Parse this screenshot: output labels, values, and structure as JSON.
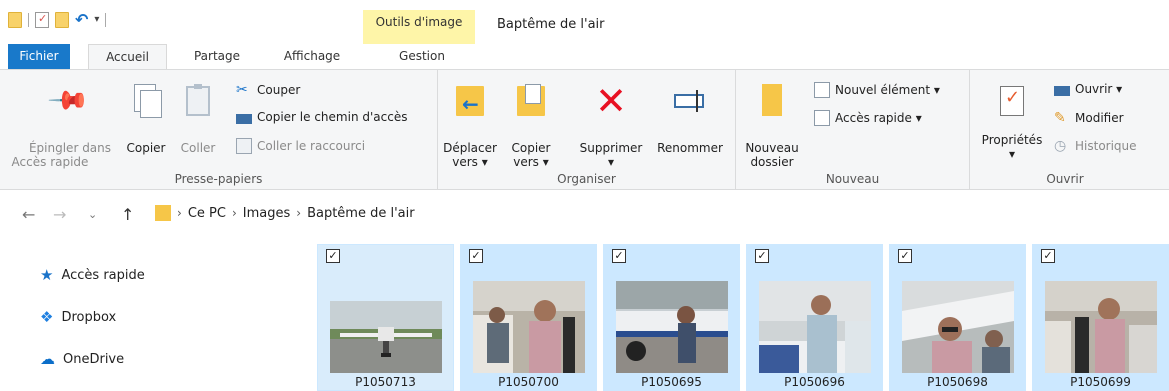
{
  "window": {
    "title": "Baptême de l'air",
    "contextual_tab_group": "Outils d'image"
  },
  "tabs": [
    {
      "label": "Fichier"
    },
    {
      "label": "Accueil"
    },
    {
      "label": "Partage"
    },
    {
      "label": "Affichage"
    },
    {
      "label": "Gestion"
    }
  ],
  "ribbon": {
    "clipboard": {
      "label": "Presse-papiers",
      "pin_line1": "Épingler dans",
      "pin_line2": "Accès rapide",
      "copy": "Copier",
      "paste": "Coller",
      "cut": "Couper",
      "copy_path": "Copier le chemin d'accès",
      "paste_shortcut": "Coller le raccourci"
    },
    "organize": {
      "label": "Organiser",
      "move_line1": "Déplacer",
      "move_line2": "vers ▾",
      "copy_line1": "Copier",
      "copy_line2": "vers ▾",
      "delete": "Supprimer",
      "delete_arrow": "▾",
      "rename": "Renommer"
    },
    "new": {
      "label": "Nouveau",
      "new_folder_line1": "Nouveau",
      "new_folder_line2": "dossier",
      "new_item": "Nouvel élément ▾",
      "quick_access": "Accès rapide ▾"
    },
    "open": {
      "label": "Ouvrir",
      "properties": "Propriétés",
      "properties_arrow": "▾",
      "open": "Ouvrir ▾",
      "edit": "Modifier",
      "history": "Historique"
    }
  },
  "address": {
    "crumbs": [
      "Ce PC",
      "Images",
      "Baptême de l'air"
    ]
  },
  "nav": [
    {
      "label": "Accès rapide"
    },
    {
      "label": "Dropbox"
    },
    {
      "label": "OneDrive"
    }
  ],
  "files": [
    {
      "name": "P1050713"
    },
    {
      "name": "P1050700"
    },
    {
      "name": "P1050695"
    },
    {
      "name": "P1050696"
    },
    {
      "name": "P1050698"
    },
    {
      "name": "P1050699"
    }
  ]
}
